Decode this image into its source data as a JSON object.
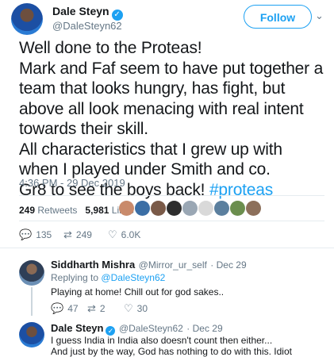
{
  "tweet": {
    "author_name": "Dale Steyn",
    "author_handle": "@DaleSteyn62",
    "follow_label": "Follow",
    "lines": [
      "Well done to the Proteas!",
      "Mark and Faf seem to have put together a team that looks hungry, has fight, but above all look menacing with real intent towards their skill.",
      "All characteristics that I grew up with when I played under Smith and co."
    ],
    "last_line_prefix": "Gr8 to see the boys back! ",
    "hashtag": "#proteas",
    "timestamp": "4:36 PM - 29 Dec 2019",
    "retweets_count": "249",
    "retweets_label": "Retweets",
    "likes_count": "5,981",
    "likes_label": "Likes",
    "likers_count": 9,
    "actions": {
      "reply_count": "135",
      "retweet_count": "249",
      "like_count": "6.0K"
    }
  },
  "replies": [
    {
      "author_name": "Siddharth Mishra",
      "author_handle": "@Mirror_ur_self",
      "date": "· Dec 29",
      "replying_prefix": "Replying to",
      "replying_to": "@DaleSteyn62",
      "lines": [
        "Playing at home! Chill out for god sakes.."
      ],
      "reply_count": "47",
      "retweet_count": "2",
      "like_count": "30"
    },
    {
      "author_name": "Dale Steyn",
      "author_handle": "@DaleSteyn62",
      "date": "· Dec 29",
      "lines": [
        "I guess India in India also doesn't count then either...",
        "And just by the way, God has nothing to do with this. Idiot"
      ]
    }
  ],
  "colors": {
    "accent": "#1da1f2",
    "muted": "#657786",
    "text": "#14171a",
    "divider": "#e6ecf0"
  },
  "icons": {
    "verified": "verified-badge-icon",
    "reply": "reply-icon",
    "retweet": "retweet-icon",
    "like": "heart-icon",
    "chevron": "chevron-down-icon"
  }
}
